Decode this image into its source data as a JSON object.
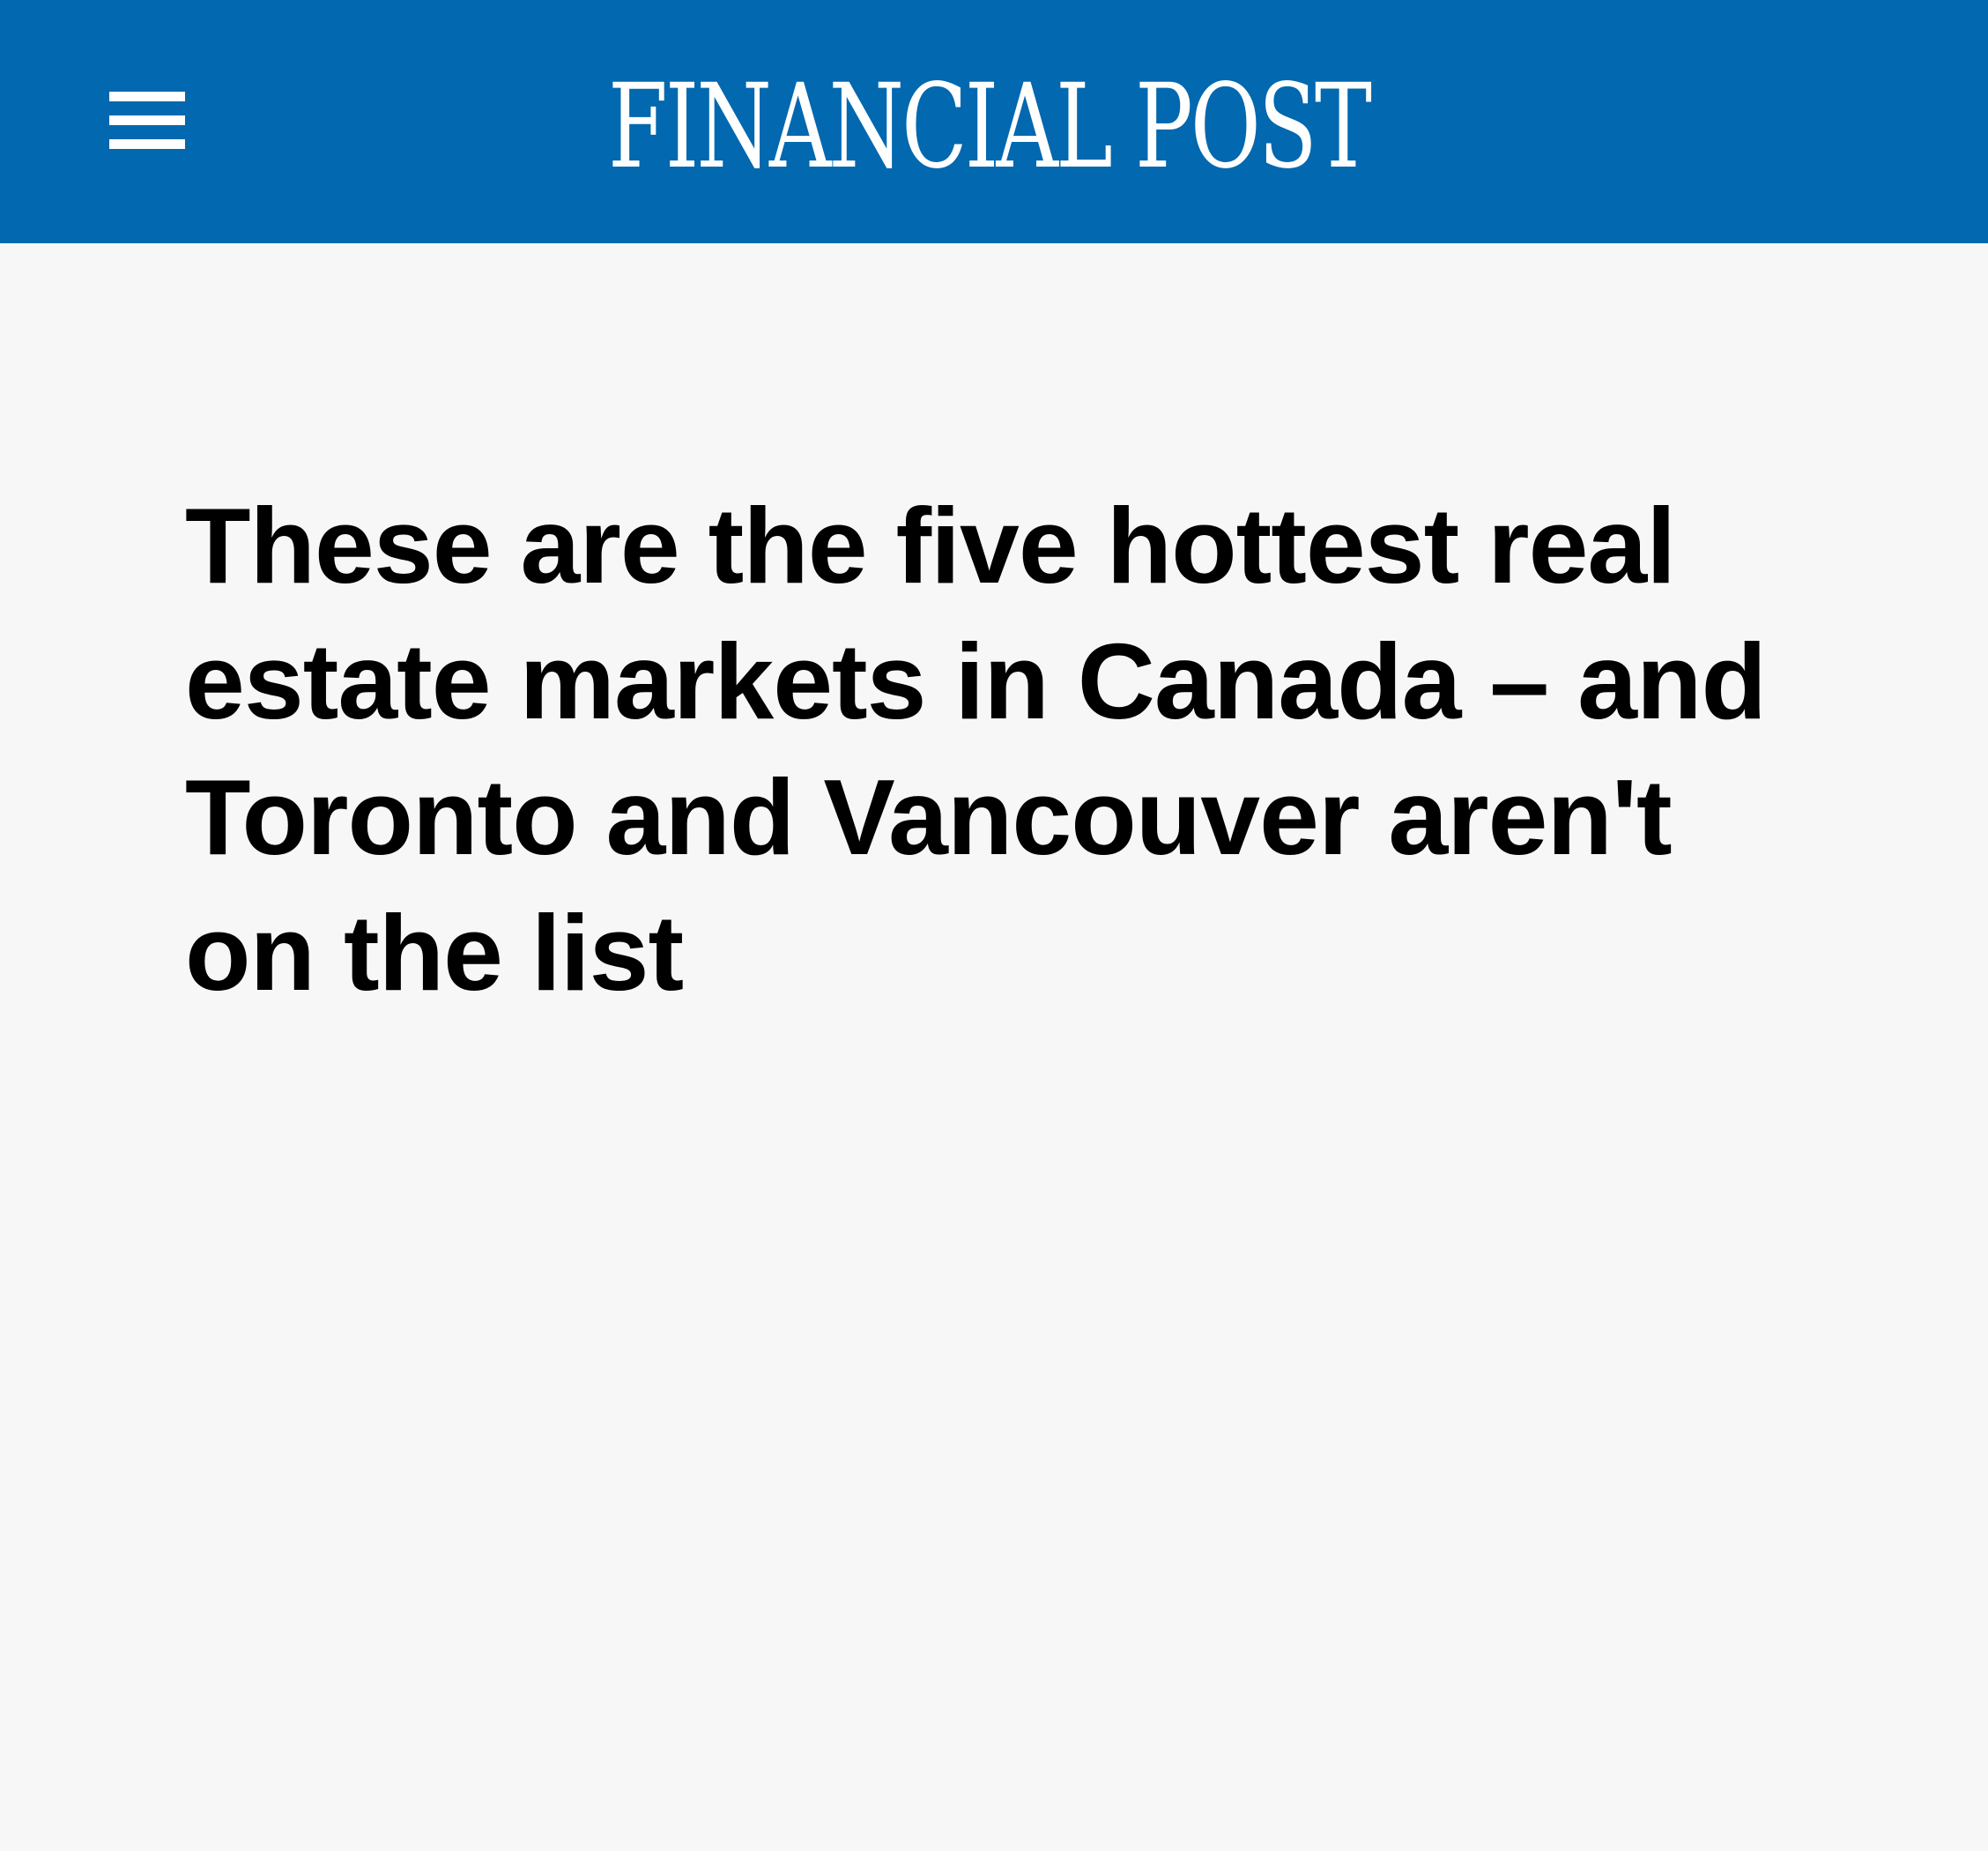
{
  "header": {
    "menu_icon": "hamburger-menu-icon",
    "logo_text": "FINANCIAL POST",
    "background_color": "#0268af"
  },
  "article": {
    "headline": "These are the five hottest real estate markets in Canada –  and Toronto and Vancouver aren't on the list"
  },
  "page": {
    "background_color": "#f7f7f7"
  }
}
